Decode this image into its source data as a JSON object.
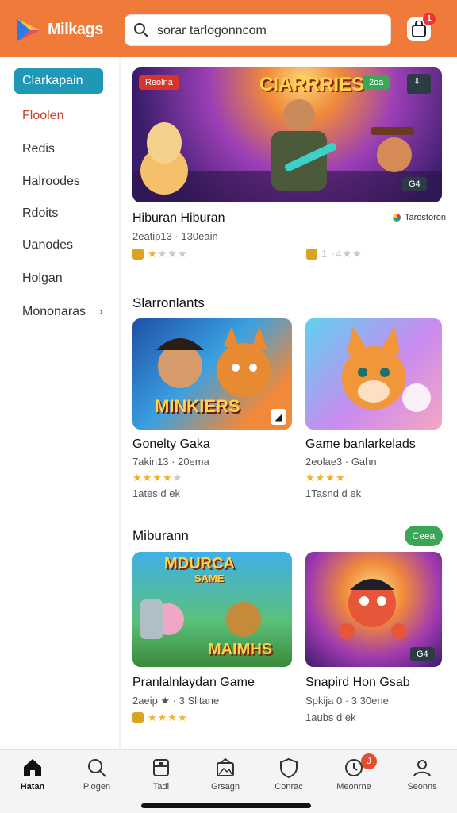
{
  "app": {
    "brand": "Milkags",
    "accent": "#f07a3a"
  },
  "search": {
    "value": "sorar tarlogonncom",
    "placeholder": ""
  },
  "notifications": {
    "count": "1"
  },
  "sidebar": {
    "items": [
      {
        "label": "Clarkapain",
        "active": true
      },
      {
        "label": "Floolen"
      },
      {
        "label": "Redis"
      },
      {
        "label": "Halroodes"
      },
      {
        "label": "Rdoits"
      },
      {
        "label": "Uanodes"
      },
      {
        "label": "Holgan"
      },
      {
        "label": "Mononaras"
      }
    ]
  },
  "featured": {
    "banner_title": "CIARRRIES",
    "badge_left": "Reolna",
    "badge_right": "2oa",
    "badge_bottom": "G4",
    "title": "Hiburan Hiburan",
    "meta": "2eatip13 · 130eain",
    "rating_right_meta": "1 ·4",
    "publisher": "Tarostoron"
  },
  "section1": {
    "title": "Slarronlants",
    "cards": [
      {
        "title": "Gonelty Gaka",
        "meta": "7akin13 · 20ema",
        "rating": 4,
        "downloads": "1ates d ek",
        "banner": "MINKIERS"
      },
      {
        "title": "Game banlarkelads",
        "meta": "2eolae3 · Gahn",
        "rating": 3.5,
        "downloads": "1Tasnd d ek",
        "banner": ""
      }
    ]
  },
  "section2": {
    "title": "Miburann",
    "pill": "Ceea",
    "cards": [
      {
        "title": "Pranlalnlaydan Game",
        "meta": "2aeip ★ · 3 Slitane",
        "rating": 3.5,
        "banner_top": "MDURCA",
        "banner_mid": "SAME",
        "banner_bot": "MAIMHS"
      },
      {
        "title": "Snapird Hon Gsab",
        "meta": "Spkija 0 · 3 30ene",
        "downloads": "1aubs d ek",
        "corner": "G4"
      }
    ]
  },
  "bottom_nav": {
    "items": [
      {
        "label": "Hatan",
        "icon": "home-icon",
        "active": true
      },
      {
        "label": "Plogen",
        "icon": "search-icon"
      },
      {
        "label": "Tadi",
        "icon": "apps-icon"
      },
      {
        "label": "Grsagn",
        "icon": "image-icon"
      },
      {
        "label": "Conrac",
        "icon": "shield-icon"
      },
      {
        "label": "Meonrne",
        "icon": "clock-icon",
        "badge": "J"
      },
      {
        "label": "Seonns",
        "icon": "user-icon"
      }
    ]
  }
}
